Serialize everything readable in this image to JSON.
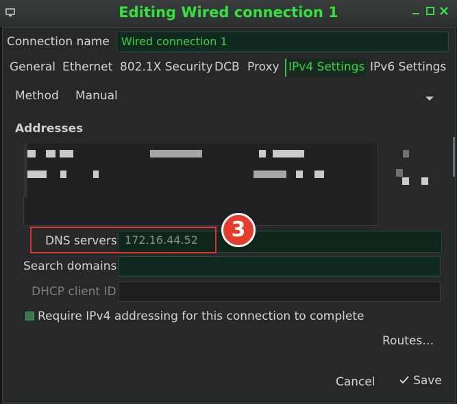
{
  "window": {
    "title": "Editing Wired connection 1"
  },
  "connection_name": {
    "label": "Connection name",
    "value": "Wired connection 1"
  },
  "tabs": [
    {
      "label": "General"
    },
    {
      "label": "Ethernet"
    },
    {
      "label": "802.1X Security"
    },
    {
      "label": "DCB"
    },
    {
      "label": "Proxy"
    },
    {
      "label": "IPv4 Settings",
      "active": true
    },
    {
      "label": "IPv6 Settings"
    }
  ],
  "method": {
    "label": "Method",
    "value": "Manual"
  },
  "addresses": {
    "heading": "Addresses"
  },
  "dns": {
    "label": "DNS servers",
    "value": "172.16.44.52"
  },
  "search_domains": {
    "label": "Search domains",
    "value": ""
  },
  "dhcp_client_id": {
    "label": "DHCP client ID",
    "value": ""
  },
  "require_ipv4": {
    "label": "Require IPv4 addressing for this connection to complete",
    "checked": true
  },
  "routes_button": {
    "label": "Routes…"
  },
  "footer": {
    "cancel": "Cancel",
    "save": "Save"
  },
  "annotation": {
    "step": "3"
  },
  "colors": {
    "accent": "#35e13c",
    "highlight": "#e03232"
  }
}
